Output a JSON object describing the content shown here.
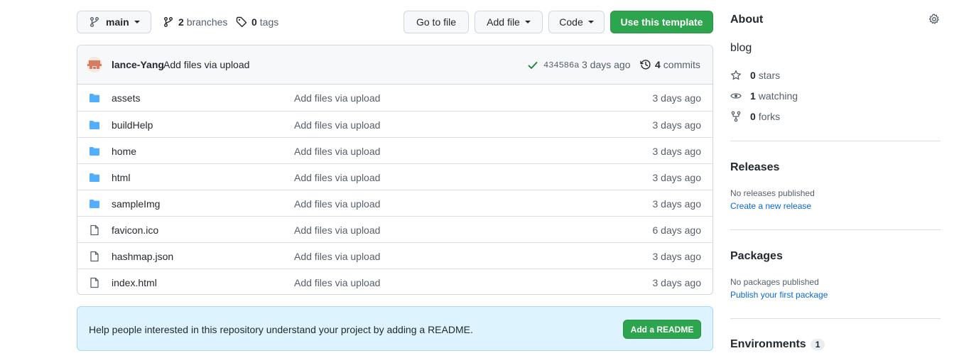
{
  "toolbar": {
    "branch_label": "main",
    "branches_count": "2",
    "branches_label": "branches",
    "tags_count": "0",
    "tags_label": "tags",
    "goto_file": "Go to file",
    "add_file": "Add file",
    "code": "Code",
    "use_template": "Use this template"
  },
  "commit": {
    "author": "lance-Yang",
    "message": "Add files via upload",
    "sha": "434586a",
    "date": "3 days ago",
    "commits_count": "4",
    "commits_label": "commits"
  },
  "files": [
    {
      "name": "assets",
      "type": "folder",
      "message": "Add files via upload",
      "date": "3 days ago"
    },
    {
      "name": "buildHelp",
      "type": "folder",
      "message": "Add files via upload",
      "date": "3 days ago"
    },
    {
      "name": "home",
      "type": "folder",
      "message": "Add files via upload",
      "date": "3 days ago"
    },
    {
      "name": "html",
      "type": "folder",
      "message": "Add files via upload",
      "date": "3 days ago"
    },
    {
      "name": "sampleImg",
      "type": "folder",
      "message": "Add files via upload",
      "date": "3 days ago"
    },
    {
      "name": "favicon.ico",
      "type": "file",
      "message": "Add files via upload",
      "date": "6 days ago"
    },
    {
      "name": "hashmap.json",
      "type": "file",
      "message": "Add files via upload",
      "date": "3 days ago"
    },
    {
      "name": "index.html",
      "type": "file",
      "message": "Add files via upload",
      "date": "3 days ago"
    }
  ],
  "readme": {
    "text": "Help people interested in this repository understand your project by adding a README.",
    "button": "Add a README"
  },
  "sidebar": {
    "about_title": "About",
    "description": "blog",
    "stars_count": "0",
    "stars_label": "stars",
    "watching_count": "1",
    "watching_label": "watching",
    "forks_count": "0",
    "forks_label": "forks",
    "releases_title": "Releases",
    "releases_note": "No releases published",
    "releases_link": "Create a new release",
    "packages_title": "Packages",
    "packages_note": "No packages published",
    "packages_link": "Publish your first package",
    "environments_title": "Environments",
    "environments_count": "1"
  },
  "colors": {
    "accent_green": "#2da44e",
    "link_blue": "#0969da",
    "folder_blue": "#54aeff",
    "banner_bg": "#ddf4ff"
  }
}
